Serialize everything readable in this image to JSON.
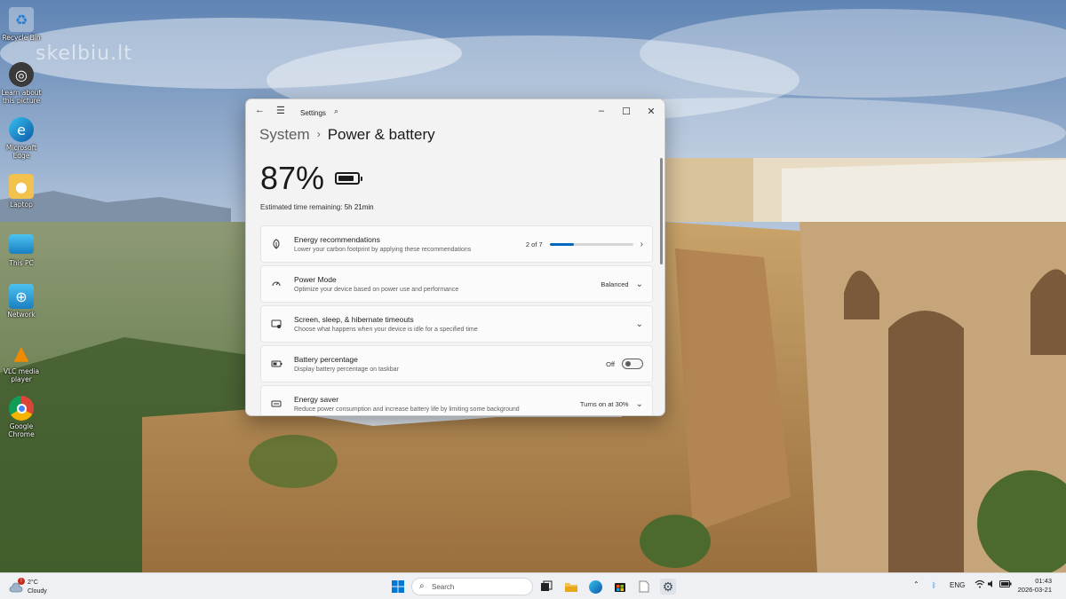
{
  "desktop": {
    "watermark": "skelbiu.lt",
    "icons": [
      {
        "label": "Recycle Bin",
        "icon": "recycle-bin-icon"
      },
      {
        "label": "Learn about this picture",
        "icon": "camera-icon"
      },
      {
        "label": "Microsoft Edge",
        "icon": "edge-icon"
      },
      {
        "label": "Laptop",
        "icon": "user-folder-icon"
      },
      {
        "label": "This PC",
        "icon": "monitor-icon"
      },
      {
        "label": "Network",
        "icon": "network-icon"
      },
      {
        "label": "VLC media player",
        "icon": "vlc-icon"
      },
      {
        "label": "Google Chrome",
        "icon": "chrome-icon"
      }
    ]
  },
  "window": {
    "app_title": "Settings",
    "breadcrumb": {
      "parent": "System",
      "separator": "›",
      "current": "Power & battery"
    },
    "battery": {
      "percent_label": "87%",
      "level": 0.87
    },
    "estimate": {
      "label": "Estimated time remaining:",
      "value": "5h 21min"
    },
    "cards": [
      {
        "title": "Energy recommendations",
        "desc": "Lower your carbon footprint by applying these recommendations",
        "right_text": "2 of 7",
        "progress": 0.29,
        "icon": "leaf-icon"
      },
      {
        "title": "Power Mode",
        "desc": "Optimize your device based on power use and performance",
        "right_text": "Balanced",
        "icon": "power-mode-icon"
      },
      {
        "title": "Screen, sleep, & hibernate timeouts",
        "desc": "Choose what happens when your device is idle for a specified time",
        "right_text": "",
        "icon": "screen-sleep-icon"
      },
      {
        "title": "Battery percentage",
        "desc": "Display battery percentage on taskbar",
        "right_text": "Off",
        "icon": "battery-icon"
      },
      {
        "title": "Energy saver",
        "desc": "Reduce power consumption and increase battery life by limiting some background",
        "right_text": "Turns on at 30%",
        "icon": "energy-saver-icon"
      }
    ]
  },
  "taskbar": {
    "weather": {
      "temp": "2°C",
      "condition": "Cloudy",
      "badge": "!"
    },
    "search_placeholder": "Search",
    "tray": {
      "language": "ENG",
      "time": "01:43",
      "date": "2026-03-21"
    }
  },
  "colors": {
    "accent": "#0067c0",
    "window_bg": "#f3f3f3",
    "card_bg": "#fbfbfb",
    "taskbar_bg": "#eef0f3"
  }
}
